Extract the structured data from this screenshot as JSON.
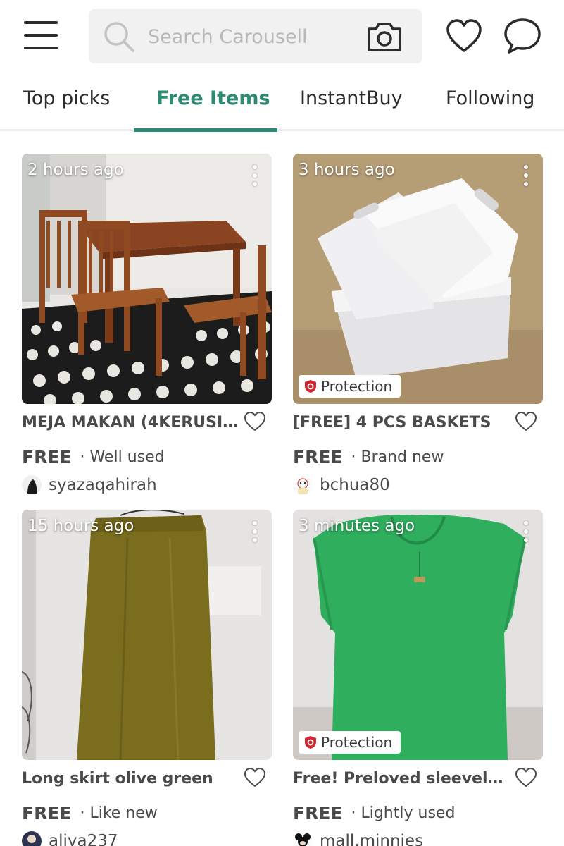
{
  "search": {
    "placeholder": "Search Carousell"
  },
  "tabs": [
    {
      "label": "Top picks",
      "active": false
    },
    {
      "label": "Free Items",
      "active": true
    },
    {
      "label": "InstantBuy",
      "active": false
    },
    {
      "label": "Following",
      "active": false
    }
  ],
  "colors": {
    "accent": "#2b8a72",
    "protection_icon": "#d3262f",
    "text": "#4a4a4b"
  },
  "icons": {
    "menu": "hamburger-icon",
    "search": "search-icon",
    "camera": "camera-icon",
    "likes": "heart-icon",
    "chat": "chat-bubble-icon",
    "more": "more-vertical-icon",
    "protection": "shield-icon"
  },
  "listings": [
    {
      "time": "2 hours ago",
      "title": "MEJA MAKAN (4KERUSI...",
      "price": "FREE",
      "condition": "· Well used",
      "seller": "syazaqahirah",
      "protection": ""
    },
    {
      "time": "3 hours ago",
      "title": "[FREE] 4 PCS BASKETS",
      "price": "FREE",
      "condition": "· Brand new",
      "seller": "bchua80",
      "protection": "Protection"
    },
    {
      "time": "15 hours ago",
      "title": "Long skirt olive green",
      "price": "FREE",
      "condition": "· Like new",
      "seller": "aliya237",
      "protection": ""
    },
    {
      "time": "3 minutes ago",
      "title": "Free! Preloved sleeveles...",
      "price": "FREE",
      "condition": "· Lightly used",
      "seller": "mall.minnies",
      "protection": "Protection"
    }
  ]
}
